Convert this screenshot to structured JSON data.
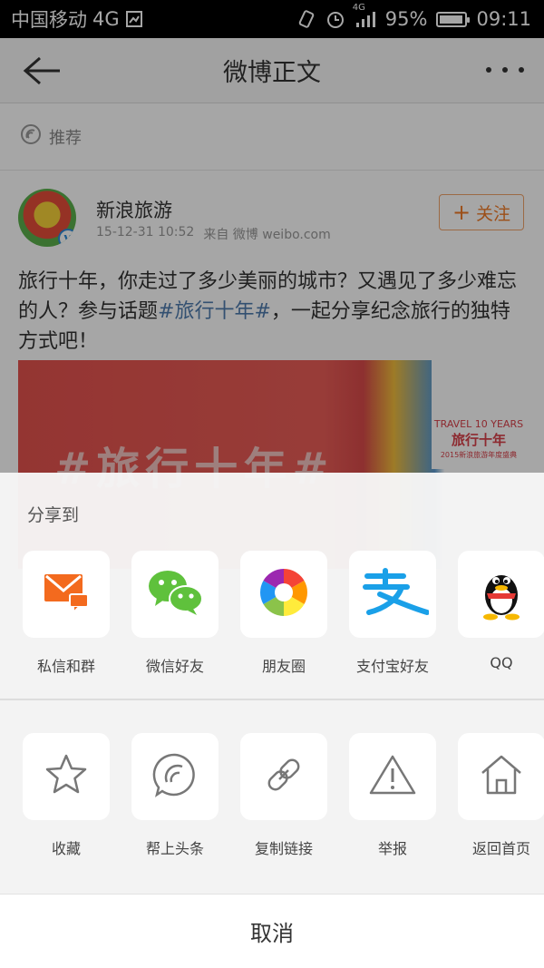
{
  "status_bar": {
    "carrier": "中国移动",
    "network": "4G",
    "signal_net": "4G",
    "battery": "95%",
    "battery_level": 0.95,
    "time": "09:11"
  },
  "header": {
    "title": "微博正文"
  },
  "recommend": {
    "label": "推荐"
  },
  "post": {
    "author": "新浪旅游",
    "time": "15-12-31 10:52",
    "source": "来自 微博 weibo.com",
    "follow_label": "关注",
    "text_before": "旅行十年，你走过了多少美丽的城市？又遇见了多少难忘的人？参与话题",
    "topic": "#旅行十年#",
    "text_after": "，一起分享纪念旅行的独特方式吧！",
    "banner_text": "#旅行十年#",
    "banner_side_en": "TRAVEL 10 YEARS",
    "banner_side_cn": "旅行十年",
    "banner_side_sub": "2015新浪旅游年度盛典"
  },
  "share_sheet": {
    "title": "分享到",
    "row1": [
      {
        "label": "私信和群",
        "icon": "message-group-icon"
      },
      {
        "label": "微信好友",
        "icon": "wechat-icon"
      },
      {
        "label": "朋友圈",
        "icon": "moments-icon"
      },
      {
        "label": "支付宝好友",
        "icon": "alipay-icon"
      },
      {
        "label": "QQ",
        "icon": "qq-icon"
      }
    ],
    "row2": [
      {
        "label": "收藏",
        "icon": "star-icon"
      },
      {
        "label": "帮上头条",
        "icon": "headline-icon"
      },
      {
        "label": "复制链接",
        "icon": "link-icon"
      },
      {
        "label": "举报",
        "icon": "warning-icon"
      },
      {
        "label": "返回首页",
        "icon": "home-icon"
      }
    ],
    "cancel": "取消"
  },
  "colors": {
    "accent_orange": "#f07a25",
    "topic_blue": "#4f7cae",
    "wechat_green": "#5fc13c",
    "alipay_blue": "#1aa0e8"
  }
}
